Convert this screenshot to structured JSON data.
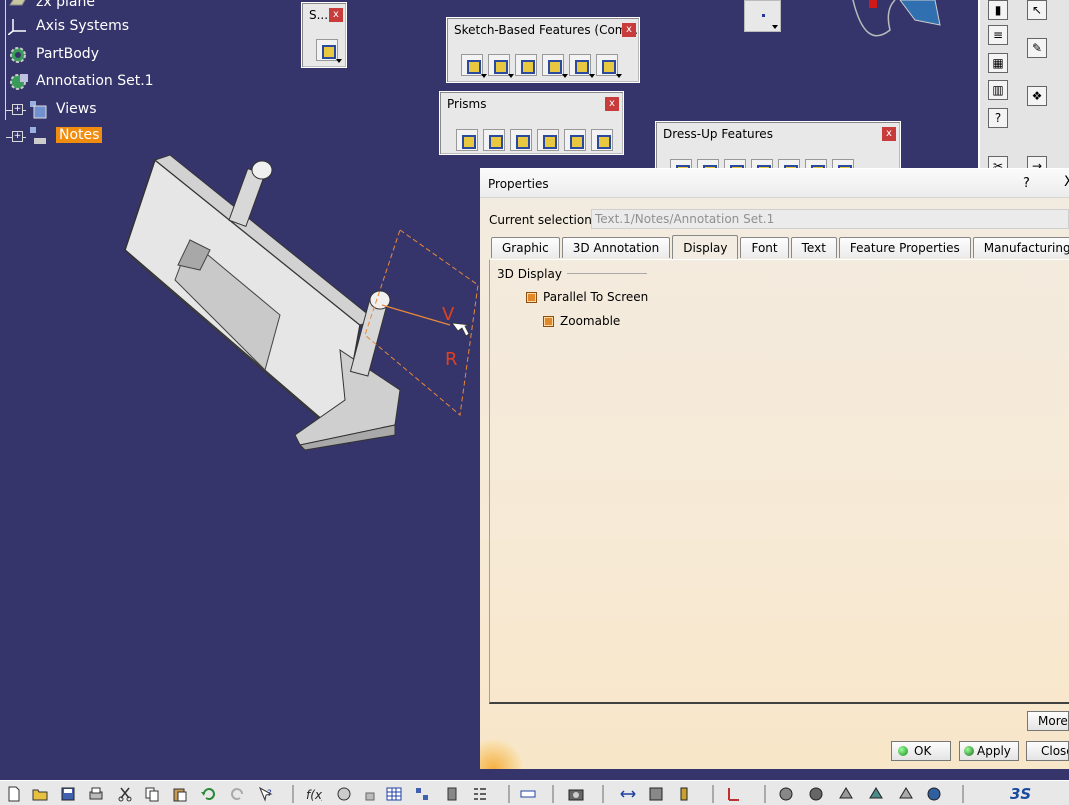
{
  "tree": {
    "items": [
      {
        "label": "zx plane"
      },
      {
        "label": "Axis Systems"
      },
      {
        "label": "PartBody"
      },
      {
        "label": "Annotation Set.1"
      },
      {
        "label": "Views"
      },
      {
        "label": "Notes"
      }
    ]
  },
  "toolbars": {
    "s_short": {
      "title": "S..."
    },
    "sketch_based": {
      "title": "Sketch-Based Features (Com..."
    },
    "prisms": {
      "title": "Prisms"
    },
    "dress_up": {
      "title": "Dress-Up Features"
    },
    "close_glyph": "x"
  },
  "annotation": {
    "letter_v": "V",
    "letter_r": "R"
  },
  "dialog": {
    "title": "Properties",
    "help": "?",
    "close": "X",
    "current_selection_label": "Current selection :",
    "current_selection_value": "Text.1/Notes/Annotation Set.1",
    "tabs": [
      {
        "label": "Graphic"
      },
      {
        "label": "3D Annotation"
      },
      {
        "label": "Display",
        "active": true
      },
      {
        "label": "Font"
      },
      {
        "label": "Text"
      },
      {
        "label": "Feature Properties"
      },
      {
        "label": "Manufacturing"
      }
    ],
    "group_label": "3D Display",
    "options": [
      {
        "label": "Parallel To Screen"
      },
      {
        "label": "Zoomable"
      }
    ],
    "buttons": {
      "more": "More...",
      "ok": "OK",
      "apply": "Apply",
      "close": "Close"
    }
  },
  "colors": {
    "background": "#35356b",
    "highlight": "#f08c10",
    "dialog_bg": "#f6ead8",
    "annotation": "#e04020"
  }
}
